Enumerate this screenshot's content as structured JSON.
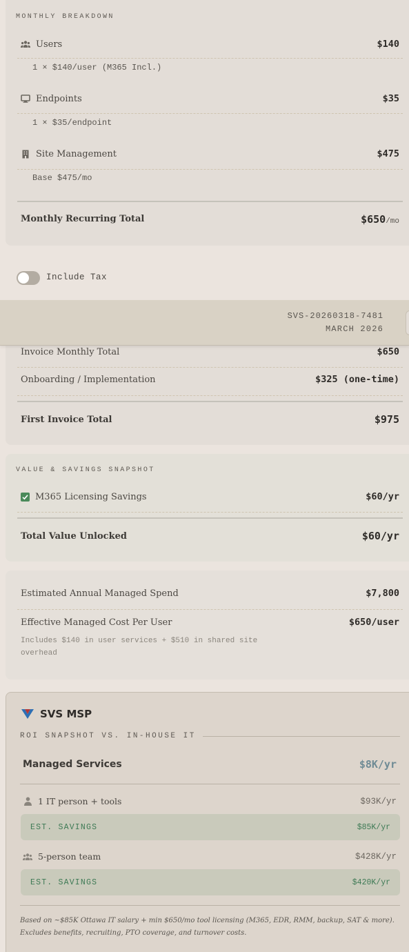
{
  "breakdown": {
    "title": "MONTHLY BREAKDOWN",
    "users": {
      "icon": "users-icon",
      "label": "Users",
      "value": "$140",
      "detail": "1 × $140/user (M365 Incl.)"
    },
    "endpoints": {
      "icon": "monitor-icon",
      "label": "Endpoints",
      "value": "$35",
      "detail": "1 × $35/endpoint"
    },
    "site": {
      "icon": "building-icon",
      "label": "Site Management",
      "value": "$475",
      "detail": "Base $475/mo"
    },
    "total_label": "Monthly Recurring Total",
    "total_value": "$650",
    "total_suffix": "/mo"
  },
  "tax": {
    "label": "Include Tax",
    "enabled": false
  },
  "invoice": {
    "number": "SVS-20260318-7481",
    "date": "MARCH 2026",
    "monthly_label": "Invoice Monthly Total",
    "monthly_value": "$650",
    "onboarding_label": "Onboarding / Implementation",
    "onboarding_value": "$325 (one-time)",
    "first_label": "First Invoice Total",
    "first_value": "$975"
  },
  "value": {
    "title": "VALUE & SAVINGS SNAPSHOT",
    "m365_icon": "checkbox-checked-icon",
    "m365_label": "M365 Licensing Savings",
    "m365_value": "$60/yr",
    "total_label": "Total Value Unlocked",
    "total_value": "$60/yr"
  },
  "annual": {
    "spend_label": "Estimated Annual Managed Spend",
    "spend_value": "$7,800",
    "per_user_label": "Effective Managed Cost Per User",
    "per_user_value": "$650/user",
    "per_user_note_1": "Includes $140 in user services + $510 in shared site",
    "per_user_note_2": "overhead"
  },
  "roi": {
    "brand": "SVS MSP",
    "subtitle": "ROI SNAPSHOT VS. IN-HOUSE IT",
    "managed_label": "Managed Services",
    "managed_value": "$8K/yr",
    "person_icon": "person-icon",
    "person_label": "1 IT person + tools",
    "person_value": "$93K/yr",
    "savings1_label": "EST. SAVINGS",
    "savings1_value": "$85K/yr",
    "team_icon": "team-icon",
    "team_label": "5-person team",
    "team_value": "$428K/yr",
    "savings2_label": "EST. SAVINGS",
    "savings2_value": "$420K/yr",
    "footnote_1": "Based on ~$85K Ottawa IT salary + min $650/mo tool licensing (M365, EDR, RMM, backup, SAT & more).",
    "footnote_2": "Excludes benefits, recruiting, PTO coverage, and turnover costs."
  },
  "colors": {
    "background": "#ebe4de",
    "card": "#e3ddd7",
    "invoice_header": "#d9d2c5",
    "savings_bg": "#c9cabb",
    "savings_text": "#3e7a55",
    "roi_accent": "#6f8b95",
    "check_green": "#4a8a5a",
    "logo_blue": "#2d6fb4",
    "logo_red": "#b23a3a"
  }
}
